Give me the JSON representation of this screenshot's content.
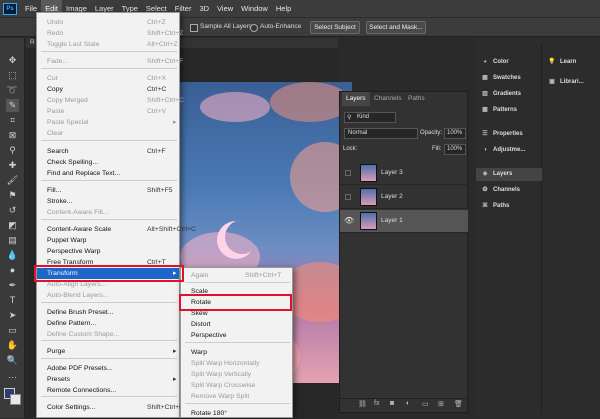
{
  "app": {
    "logo": "Ps"
  },
  "menubar": [
    "File",
    "Edit",
    "Image",
    "Layer",
    "Type",
    "Select",
    "Filter",
    "3D",
    "View",
    "Window",
    "Help"
  ],
  "options": {
    "sample_all_layers": "Sample All Layers",
    "auto_enhance": "Auto-Enhance",
    "select_subject": "Select Subject",
    "select_and_mask": "Select and Mask..."
  },
  "doc_tab": "R",
  "edit_menu": [
    {
      "label": "Undo",
      "shortcut": "Ctrl+Z",
      "dis": true
    },
    {
      "label": "Redo",
      "shortcut": "Shift+Ctrl+Z",
      "dis": true
    },
    {
      "label": "Toggle Last State",
      "shortcut": "Alt+Ctrl+Z",
      "dis": true
    },
    {
      "label": "Fade...",
      "shortcut": "Shift+Ctrl+F",
      "dis": true
    },
    {
      "label": "Cut",
      "shortcut": "Ctrl+X",
      "dis": true
    },
    {
      "label": "Copy",
      "shortcut": "Ctrl+C"
    },
    {
      "label": "Copy Merged",
      "shortcut": "Shift+Ctrl+C",
      "dis": true
    },
    {
      "label": "Paste",
      "shortcut": "Ctrl+V",
      "dis": true
    },
    {
      "label": "Paste Special",
      "shortcut": "▸",
      "dis": true
    },
    {
      "label": "Clear",
      "shortcut": "",
      "dis": true
    },
    {
      "label": "Search",
      "shortcut": "Ctrl+F"
    },
    {
      "label": "Check Spelling...",
      "shortcut": ""
    },
    {
      "label": "Find and Replace Text...",
      "shortcut": ""
    },
    {
      "label": "Fill...",
      "shortcut": "Shift+F5"
    },
    {
      "label": "Stroke...",
      "shortcut": ""
    },
    {
      "label": "Content-Aware Fill...",
      "shortcut": "",
      "dis": true
    },
    {
      "label": "Content-Aware Scale",
      "shortcut": "Alt+Shift+Ctrl+C"
    },
    {
      "label": "Puppet Warp",
      "shortcut": ""
    },
    {
      "label": "Perspective Warp",
      "shortcut": ""
    },
    {
      "label": "Free Transform",
      "shortcut": "Ctrl+T"
    },
    {
      "label": "Transform",
      "shortcut": "▸",
      "hl": true
    },
    {
      "label": "Auto-Align Layers...",
      "shortcut": "",
      "dis": true
    },
    {
      "label": "Auto-Blend Layers...",
      "shortcut": "",
      "dis": true
    },
    {
      "label": "Define Brush Preset...",
      "shortcut": ""
    },
    {
      "label": "Define Pattern...",
      "shortcut": ""
    },
    {
      "label": "Define Custom Shape...",
      "shortcut": "",
      "dis": true
    },
    {
      "label": "Purge",
      "shortcut": "▸"
    },
    {
      "label": "Adobe PDF Presets...",
      "shortcut": ""
    },
    {
      "label": "Presets",
      "shortcut": "▸"
    },
    {
      "label": "Remote Connections...",
      "shortcut": ""
    },
    {
      "label": "Color Settings...",
      "shortcut": "Shift+Ctrl+K"
    }
  ],
  "transform_menu": [
    {
      "label": "Again",
      "shortcut": "Shift+Ctrl+T",
      "dis": true
    },
    {
      "label": "Scale",
      "shortcut": ""
    },
    {
      "label": "Rotate",
      "shortcut": ""
    },
    {
      "label": "Skew",
      "shortcut": ""
    },
    {
      "label": "Distort",
      "shortcut": ""
    },
    {
      "label": "Perspective",
      "shortcut": ""
    },
    {
      "label": "Warp",
      "shortcut": ""
    },
    {
      "label": "Split Warp Horizontally",
      "shortcut": "",
      "dis": true
    },
    {
      "label": "Split Warp Vertically",
      "shortcut": "",
      "dis": true
    },
    {
      "label": "Split Warp Crosswise",
      "shortcut": "",
      "dis": true
    },
    {
      "label": "Remove Warp Split",
      "shortcut": "",
      "dis": true
    },
    {
      "label": "Rotate 180°",
      "shortcut": ""
    }
  ],
  "layers_panel": {
    "tabs": [
      "Layers",
      "Channels",
      "Paths"
    ],
    "kind": "Kind",
    "blend": "Normal",
    "opacity_label": "Opacity:",
    "opacity": "100%",
    "lock_label": "Lock:",
    "fill_label": "Fill:",
    "fill": "100%",
    "layers": [
      "Layer 3",
      "Layer 2",
      "Layer 1"
    ]
  },
  "right_panels": {
    "col1": [
      "Color",
      "Swatches",
      "Gradients",
      "Patterns",
      "Properties",
      "Adjustme...",
      "Layers",
      "Channels",
      "Paths"
    ],
    "col2": [
      "Learn",
      "Librari..."
    ]
  }
}
